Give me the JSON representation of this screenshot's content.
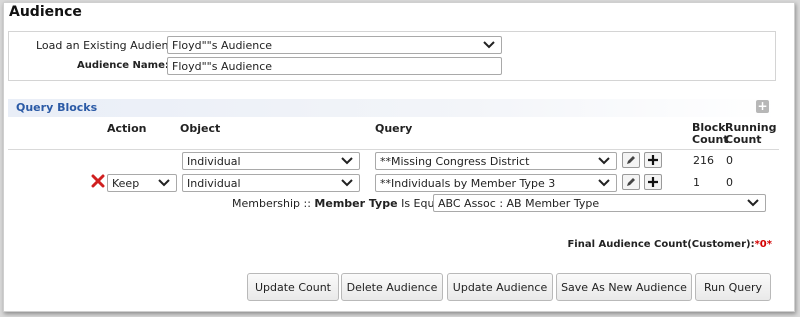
{
  "page": {
    "title": "Audience"
  },
  "load_audience": {
    "label": "Load an Existing Audience:",
    "selected": "Floyd\"\"s Audience"
  },
  "audience_name": {
    "label": "Audience Name:",
    "required_mark": "*",
    "value": "Floyd\"\"s  Audience"
  },
  "query_blocks": {
    "title": "Query Blocks",
    "add_icon_glyph": "+",
    "columns": {
      "action": "Action",
      "object": "Object",
      "query": "Query",
      "block_count": "Block Count",
      "running_count": "Running Count"
    },
    "rows": [
      {
        "action": "",
        "object": "Individual",
        "query": "**Missing Congress District",
        "block_count": "216",
        "running_count": "0"
      },
      {
        "action": "Keep",
        "object": "Individual",
        "query": "**Individuals by Member Type 3",
        "block_count": "1",
        "running_count": "0"
      }
    ],
    "criteria": {
      "prefix": "Membership :: ",
      "field": "Member Type",
      "operator": " Is Equal To",
      "value": "ABC Assoc : AB Member Type"
    },
    "icons": {
      "delete": "delete-x-icon",
      "edit": "pencil-icon",
      "add": "plus-icon"
    }
  },
  "final_count": {
    "label": "Final Audience Count(Customer):",
    "value": "*0*"
  },
  "buttons": {
    "update_count": "Update Count",
    "delete_audience": "Delete Audience",
    "update_audience": "Update Audience",
    "save_as_new": "Save As New Audience",
    "run_query": "Run Query"
  },
  "colors": {
    "accent": "#2b5aa6",
    "required": "#d40000",
    "delete": "#d01f1f"
  }
}
